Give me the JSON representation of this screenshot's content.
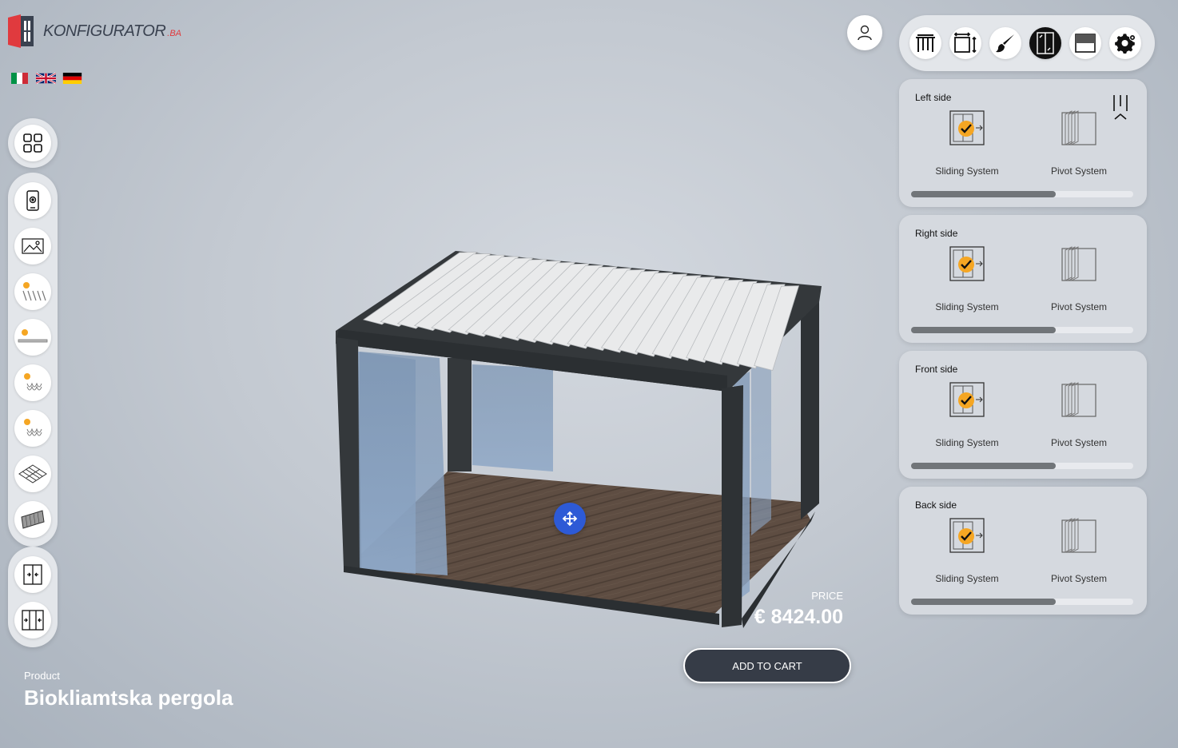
{
  "brand": {
    "name": "KONFIGURATOR",
    "suffix": ".BA"
  },
  "languages": [
    {
      "code": "it",
      "icon": "flag-italy-icon"
    },
    {
      "code": "en",
      "icon": "flag-uk-icon"
    },
    {
      "code": "de",
      "icon": "flag-germany-icon"
    }
  ],
  "sidebar": {
    "icons": [
      "grid-icon",
      "ar-view-icon",
      "background-image-icon",
      "lamella-light-icon",
      "flat-light-icon",
      "spiral-light-icon",
      "spiral-light-icon",
      "tiles-icon",
      "roof-panel-icon",
      "sliding-door-icon",
      "pivot-door-icon"
    ]
  },
  "toolbar": {
    "icons": [
      "pergola-icon",
      "dimensions-icon",
      "paint-brush-icon",
      "glass-door-icon",
      "shade-icon",
      "settings-icon"
    ],
    "active_index": 3
  },
  "panels": [
    {
      "title": "Left side",
      "options": [
        "Sliding System",
        "Pivot System"
      ],
      "selected": "Sliding System",
      "progress": 0.65
    },
    {
      "title": "Right side",
      "options": [
        "Sliding System",
        "Pivot System"
      ],
      "selected": "Sliding System",
      "progress": 0.65
    },
    {
      "title": "Front side",
      "options": [
        "Sliding System",
        "Pivot System"
      ],
      "selected": "Sliding System",
      "progress": 0.65
    },
    {
      "title": "Back side",
      "options": [
        "Sliding System",
        "Pivot System"
      ],
      "selected": "Sliding System",
      "progress": 0.65
    }
  ],
  "price": {
    "label": "PRICE",
    "value": "€ 8424.00"
  },
  "cart": {
    "label": "ADD TO CART"
  },
  "product": {
    "label": "Product",
    "name": "Biokliamtska pergola"
  },
  "colors": {
    "accent": "#2d5ad6",
    "frame": "#363c47",
    "check": "#f5a623",
    "brand_red": "#e03a3e"
  }
}
